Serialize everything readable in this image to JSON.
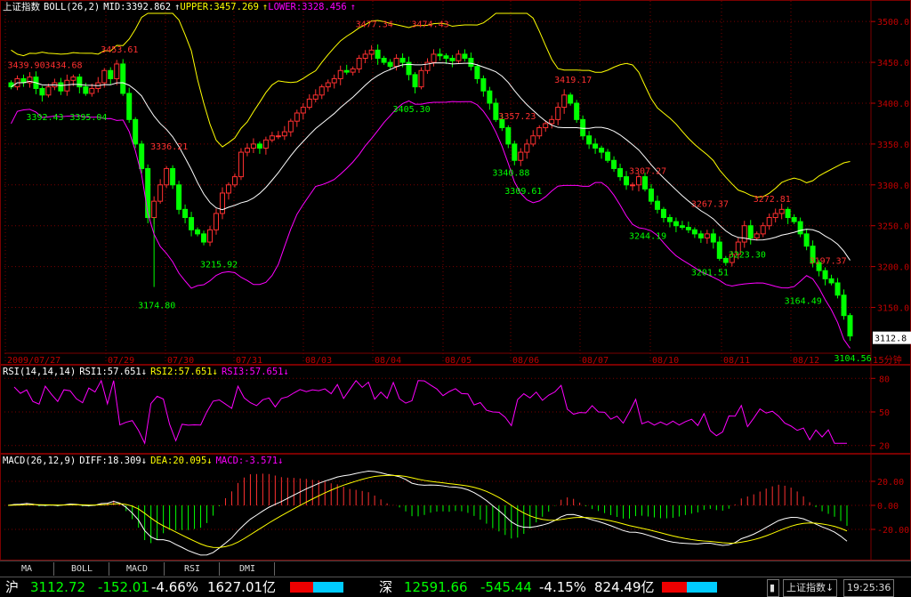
{
  "price_pane": {
    "header": {
      "title": "上证指数",
      "indicator": "BOLL(26,2)",
      "mid": "MID:3392.862",
      "upper": "UPPER:3457.269",
      "lower": "LOWER:3328.456",
      "arrow_up": "↑"
    },
    "y_ticks": [
      "3500.0",
      "3450.0",
      "3400.0",
      "3350.0",
      "3300.0",
      "3250.0",
      "3200.0",
      "3150.0"
    ],
    "x_dates": [
      "2009/07/27",
      "07/29",
      "07/30",
      "07/31",
      "08/03",
      "08/04",
      "08/05",
      "08/06",
      "08/07",
      "08/10",
      "08/11",
      "08/12"
    ],
    "current_value": "3112.8",
    "period_label": "15分钟",
    "annotations": [
      {
        "text": "3439.90",
        "color": "red",
        "value": 3440,
        "idx": 2
      },
      {
        "text": "3434.68",
        "color": "red",
        "value": 3440,
        "idx": 8
      },
      {
        "text": "3453.61",
        "color": "red",
        "value": 3459,
        "idx": 17
      },
      {
        "text": "3392.43",
        "color": "green",
        "value": 3390,
        "idx": 5
      },
      {
        "text": "3395.04",
        "color": "green",
        "value": 3390,
        "idx": 12
      },
      {
        "text": "3336.21",
        "color": "red",
        "value": 3340,
        "idx": 25
      },
      {
        "text": "3215.92",
        "color": "green",
        "value": 3210,
        "idx": 33
      },
      {
        "text": "3174.80",
        "color": "green",
        "value": 3160,
        "idx": 23
      },
      {
        "text": "3477.34",
        "color": "red",
        "value": 3490,
        "idx": 58
      },
      {
        "text": "3474.43",
        "color": "red",
        "value": 3490,
        "idx": 67
      },
      {
        "text": "3405.30",
        "color": "green",
        "value": 3400,
        "idx": 64
      },
      {
        "text": "3357.23",
        "color": "red",
        "value": 3377,
        "idx": 81
      },
      {
        "text": "3340.88",
        "color": "green",
        "value": 3322,
        "idx": 80
      },
      {
        "text": "3309.61",
        "color": "green",
        "value": 3300,
        "idx": 82
      },
      {
        "text": "3419.17",
        "color": "red",
        "value": 3422,
        "idx": 90
      },
      {
        "text": "3307.27",
        "color": "red",
        "value": 3310,
        "idx": 102
      },
      {
        "text": "3244.19",
        "color": "green",
        "value": 3245,
        "idx": 102
      },
      {
        "text": "3267.37",
        "color": "red",
        "value": 3270,
        "idx": 112
      },
      {
        "text": "3201.51",
        "color": "green",
        "value": 3200,
        "idx": 112
      },
      {
        "text": "3223.30",
        "color": "green",
        "value": 3222,
        "idx": 118
      },
      {
        "text": "3272.81",
        "color": "red",
        "value": 3276,
        "idx": 122
      },
      {
        "text": "3197.37",
        "color": "red",
        "value": 3200,
        "idx": 131
      },
      {
        "text": "3164.49",
        "color": "green",
        "value": 3165,
        "idx": 127
      },
      {
        "text": "3104.56",
        "color": "green",
        "value": 3095,
        "idx": 135
      }
    ]
  },
  "rsi_pane": {
    "header": {
      "indicator": "RSI(14,14,14)",
      "rsi1": "RSI1:57.651",
      "rsi2": "RSI2:57.651",
      "rsi3": "RSI3:57.651",
      "arrow_down": "↓"
    },
    "y_ticks": [
      "80",
      "50",
      "20"
    ]
  },
  "macd_pane": {
    "header": {
      "indicator": "MACD(26,12,9)",
      "diff": "DIFF:18.309",
      "dea": "DEA:20.095",
      "macd": "MACD:-3.571",
      "arrow_down": "↓"
    },
    "y_ticks": [
      "20.00",
      "0.00",
      "-20.00"
    ]
  },
  "tabs": [
    "MA",
    "BOLL",
    "MACD",
    "RSI",
    "DMI"
  ],
  "status": {
    "sh_label": "沪",
    "sh_index": "3112.72",
    "sh_change": "-152.01",
    "sh_pct": "-4.66%",
    "sh_amount": "1627.01亿",
    "sz_label": "深",
    "sz_index": "12591.66",
    "sz_change": "-545.44",
    "sz_pct": "-4.15%",
    "sz_amount": "824.49亿",
    "ticker": "上证指数",
    "time": "19:25:36"
  },
  "colors": {
    "up": "#ff3030",
    "down": "#00ff00",
    "mid": "#ffffff",
    "upper": "#ffff00",
    "lower": "#ff00ff",
    "grid": "#7a0000",
    "axis_text": "#c00000"
  },
  "chart_data": {
    "type": "candlestick",
    "ylim": [
      3095,
      3510
    ],
    "close_series": [
      3420,
      3430,
      3425,
      3432,
      3418,
      3410,
      3420,
      3425,
      3415,
      3428,
      3432,
      3420,
      3412,
      3418,
      3425,
      3440,
      3430,
      3448,
      3412,
      3380,
      3350,
      3320,
      3260,
      3280,
      3300,
      3320,
      3300,
      3270,
      3260,
      3245,
      3240,
      3230,
      3245,
      3265,
      3290,
      3300,
      3310,
      3340,
      3345,
      3350,
      3345,
      3355,
      3360,
      3360,
      3365,
      3378,
      3388,
      3395,
      3405,
      3410,
      3420,
      3425,
      3430,
      3440,
      3438,
      3442,
      3455,
      3460,
      3465,
      3455,
      3450,
      3445,
      3455,
      3450,
      3435,
      3420,
      3440,
      3450,
      3460,
      3458,
      3455,
      3452,
      3460,
      3455,
      3445,
      3430,
      3415,
      3400,
      3380,
      3370,
      3350,
      3330,
      3340,
      3350,
      3360,
      3370,
      3375,
      3380,
      3395,
      3410,
      3400,
      3380,
      3360,
      3350,
      3345,
      3340,
      3330,
      3320,
      3310,
      3300,
      3300,
      3310,
      3295,
      3280,
      3270,
      3260,
      3255,
      3250,
      3248,
      3245,
      3240,
      3235,
      3240,
      3230,
      3210,
      3205,
      3215,
      3230,
      3250,
      3235,
      3240,
      3250,
      3260,
      3265,
      3270,
      3260,
      3255,
      3240,
      3225,
      3205,
      3195,
      3185,
      3180,
      3165,
      3140,
      3115
    ]
  }
}
